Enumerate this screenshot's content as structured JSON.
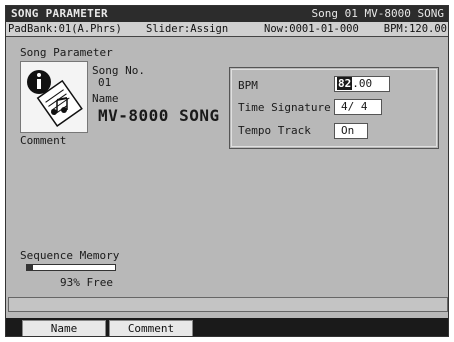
{
  "titlebar": {
    "title": "SONG PARAMETER",
    "song": "Song 01 MV-8000 SONG"
  },
  "status": {
    "padbank": "PadBank:01(A.Phrs)",
    "slider": "Slider:Assign",
    "now": "Now:0001-01-000",
    "bpm": "BPM:120.00"
  },
  "main": {
    "section_label": "Song Parameter",
    "info_icon": "info-document-icon",
    "song_no_label": "Song No.",
    "song_no_value": "01",
    "name_label": "Name",
    "name_value": "MV-8000 SONG",
    "comment_label": "Comment"
  },
  "params": {
    "bpm_label": "BPM",
    "bpm_int": "82",
    "bpm_dec": ".00",
    "timesig_label": "Time Signature",
    "timesig_value": "4/ 4",
    "tempo_label": "Tempo Track",
    "tempo_value": "On"
  },
  "memory": {
    "label": "Sequence Memory",
    "free_percent": 93,
    "free_text": "93% Free"
  },
  "functions": {
    "name": "Name",
    "comment": "Comment"
  },
  "colors": {
    "panel_bg": "#b8b8b8",
    "titlebar_bg": "#2c2c2c",
    "field_bg": "#ffffff",
    "highlight": "#1a1a1a"
  }
}
